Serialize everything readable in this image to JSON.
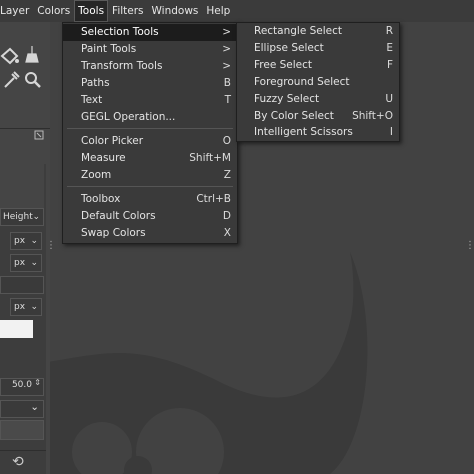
{
  "menubar": {
    "items": [
      "Layer",
      "Colors",
      "Tools",
      "Filters",
      "Windows",
      "Help"
    ]
  },
  "tools_menu": {
    "items": [
      {
        "label": "Selection Tools",
        "accel": ">",
        "highlighted": true
      },
      {
        "label": "Paint Tools",
        "accel": ">"
      },
      {
        "label": "Transform Tools",
        "accel": ">"
      },
      {
        "label": "Paths",
        "accel": "B"
      },
      {
        "label": "Text",
        "accel": "T"
      },
      {
        "label": "GEGL Operation...",
        "accel": ""
      },
      {
        "label": "Color Picker",
        "accel": "O"
      },
      {
        "label": "Measure",
        "accel": "Shift+M"
      },
      {
        "label": "Zoom",
        "accel": "Z"
      },
      {
        "label": "Toolbox",
        "accel": "Ctrl+B"
      },
      {
        "label": "Default Colors",
        "accel": "D"
      },
      {
        "label": "Swap Colors",
        "accel": "X"
      }
    ]
  },
  "selection_submenu": {
    "items": [
      {
        "label": "Rectangle Select",
        "accel": "R"
      },
      {
        "label": "Ellipse Select",
        "accel": "E"
      },
      {
        "label": "Free Select",
        "accel": "F"
      },
      {
        "label": "Foreground Select",
        "accel": ""
      },
      {
        "label": "Fuzzy Select",
        "accel": "U"
      },
      {
        "label": "By Color Select",
        "accel": "Shift+O"
      },
      {
        "label": "Intelligent Scissors",
        "accel": "I"
      }
    ]
  },
  "tool_options": {
    "height_label": "Height",
    "unit1": "px",
    "unit2": "px",
    "unit3": "px",
    "value": "50.0"
  },
  "colors": {
    "menubar_bg": "#3b3b3b",
    "menu_bg": "#3a3a3a",
    "highlight_bg": "#1c1c1c",
    "canvas_bg": "#424242"
  }
}
